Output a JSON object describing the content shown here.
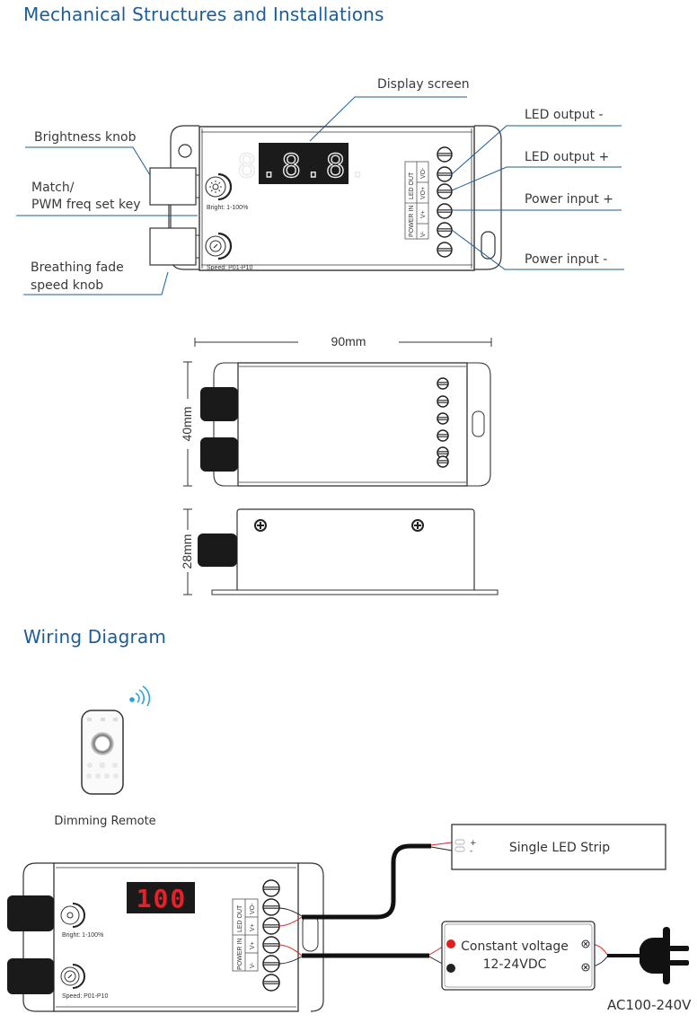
{
  "sections": {
    "mechanical_title": "Mechanical Structures and Installations",
    "wiring_title": "Wiring Diagram"
  },
  "callouts": {
    "display_screen": "Display screen",
    "brightness_knob": "Brightness knob",
    "match_key_line1": "Match/",
    "match_key_line2": "PWM freq set key",
    "breathing_line1": "Breathing fade",
    "breathing_line2": "speed knob",
    "led_output_minus": "LED output -",
    "led_output_plus": "LED output +",
    "power_input_plus": "Power input +",
    "power_input_minus": "Power input -"
  },
  "device": {
    "display_digits": "8.8.8.",
    "bright_label": "Bright: 1-100%",
    "speed_label": "Speed: P01-P10",
    "terminal_groups": [
      "LED OUT",
      "POWER IN"
    ],
    "terminal_pins": [
      "VO-",
      "VO+",
      "V+",
      "V-"
    ],
    "wiring_terminal_pins": [
      "VO-",
      "V+",
      "V+",
      "V-"
    ],
    "wiring_display_value": "100"
  },
  "dimensions": {
    "length": "90mm",
    "width": "40mm",
    "height": "28mm"
  },
  "wiring": {
    "remote_label": "Dimming Remote",
    "led_strip_label": "Single LED Strip",
    "strip_plus": "+",
    "strip_minus": "-",
    "psu_line1": "Constant voltage",
    "psu_line2": "12-24VDC",
    "mains_label": "AC100-240V"
  },
  "colors": {
    "title_blue": "#1a5c9c",
    "callout_line": "#1a5c9c",
    "display_red": "#e8202a",
    "wire_red": "#e02020",
    "wireless_blue": "#29a3e0"
  }
}
